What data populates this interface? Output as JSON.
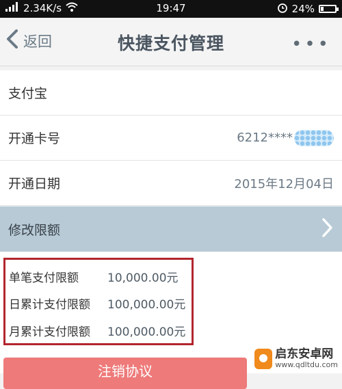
{
  "status_bar": {
    "network": "4G",
    "speed": "2.34K/s",
    "time": "19:47",
    "battery": "24%"
  },
  "navbar": {
    "back_label": "返回",
    "title": "快捷支付管理",
    "more_label": "•••"
  },
  "details": {
    "provider": "支付宝",
    "card_label": "开通卡号",
    "card_value": "6212****",
    "date_label": "开通日期",
    "date_value": "2015年12月04日"
  },
  "modify": {
    "label": "修改限额"
  },
  "limits": [
    {
      "label": "单笔支付限额",
      "value": "10,000.00元"
    },
    {
      "label": "日累计支付限额",
      "value": "100,000.00元"
    },
    {
      "label": "月累计支付限额",
      "value": "100,000.00元"
    }
  ],
  "cancel_button": {
    "label": "注销协议"
  },
  "watermark": {
    "name": "启东安卓网",
    "url": "www.qdltdu.com"
  },
  "colors": {
    "modify_bg": "#b7cad6",
    "highlight_border": "#b1252c",
    "cancel_button": "#ee7a7a"
  }
}
